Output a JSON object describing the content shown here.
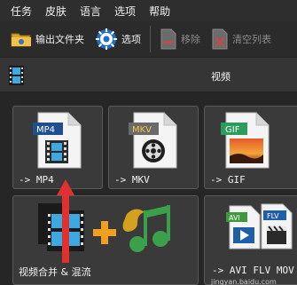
{
  "menu": [
    "任务",
    "皮肤",
    "语言",
    "选项",
    "帮助"
  ],
  "toolbar": {
    "output_folder": "输出文件夹",
    "options": "选项",
    "remove": "移除",
    "clear_list": "清空列表"
  },
  "category": {
    "label": "视频"
  },
  "tiles": {
    "mp4": {
      "badge": "MP4",
      "label": "-> MP4"
    },
    "mkv": {
      "badge": "MKV",
      "label": "-> MKV"
    },
    "gif": {
      "badge": "GIF",
      "label": "-> GIF"
    },
    "merge": {
      "label": "视频合并 & 混流"
    },
    "avi_flv": {
      "badge1": "AVI",
      "badge2": "FLV",
      "label": "-> AVI FLV MOV"
    }
  },
  "watermark": "jingyan.baidu.com",
  "colors": {
    "mp4_badge": "#1e4f8f",
    "mkv_badge": "#6a6a6a",
    "gif_badge": "#2a9d5b",
    "avi_badge": "#3e9a3e",
    "flv_badge": "#1f5fa8",
    "arrow": "#e03030"
  }
}
